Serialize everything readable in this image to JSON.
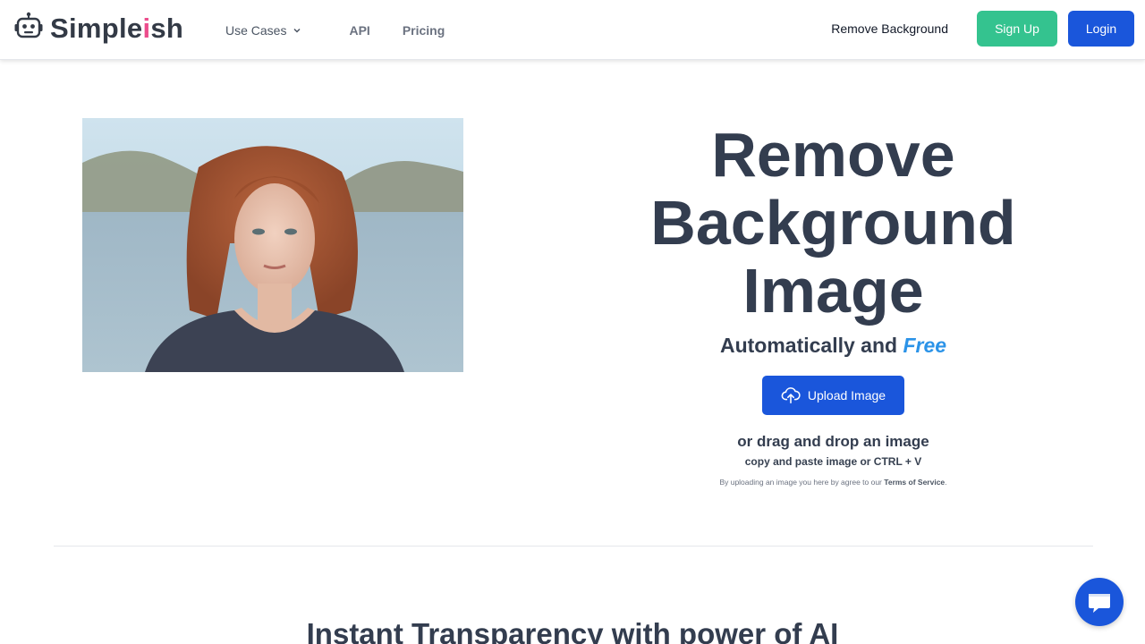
{
  "header": {
    "logo_prefix": "Simple",
    "logo_accent": "i",
    "logo_suffix": "sh",
    "nav": {
      "use_cases": "Use Cases",
      "api": "API",
      "pricing": "Pricing"
    },
    "remove_background": "Remove Background",
    "sign_up": "Sign Up",
    "login": "Login"
  },
  "hero": {
    "title_line1": "Remove",
    "title_line2": "Background",
    "title_line3": "Image",
    "subtitle_prefix": "Automatically and",
    "subtitle_free": "Free",
    "upload_label": "Upload Image",
    "drag_text": "or drag and drop an image",
    "paste_text": "copy and paste image or CTRL + V",
    "terms_prefix": "By uploading an image you here by agree to our",
    "terms_link": "Terms of Service",
    "terms_suffix": "."
  },
  "section": {
    "title": "Instant Transparency with power of AI"
  },
  "colors": {
    "primary": "#1a56db",
    "signup": "#34c38f",
    "heading": "#333d4f",
    "accent_pink": "#ec4d8c",
    "free_blue": "#2b93e8"
  },
  "icons": {
    "logo": "robot-icon",
    "use_cases_chevron": "chevron-down-icon",
    "upload": "cloud-upload-icon",
    "chat": "chat-icon"
  }
}
